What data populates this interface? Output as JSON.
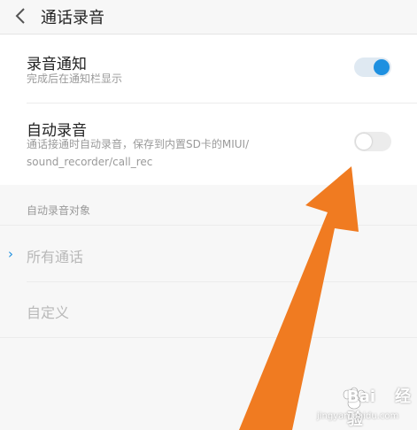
{
  "header": {
    "title": "通话录音",
    "back_icon": "chevron-left-icon"
  },
  "settings": {
    "notify": {
      "label": "录音通知",
      "sub": "完成后在通知栏显示",
      "enabled": true
    },
    "auto": {
      "label": "自动录音",
      "sub_line1": "通话接通时自动录音，保存到内置SD卡的MIUI/",
      "sub_line2": "sound_recorder/call_rec",
      "enabled": false
    }
  },
  "targets": {
    "section_label": "自动录音对象",
    "options": [
      {
        "label": "所有通话",
        "selected": true
      },
      {
        "label": "自定义",
        "selected": false
      }
    ]
  },
  "colors": {
    "accent": "#1e90e0",
    "arrow": "#f07b21"
  },
  "watermark": {
    "brand": "Bai",
    "brand_after": "经验",
    "url": "jingyan.baidu.com"
  }
}
